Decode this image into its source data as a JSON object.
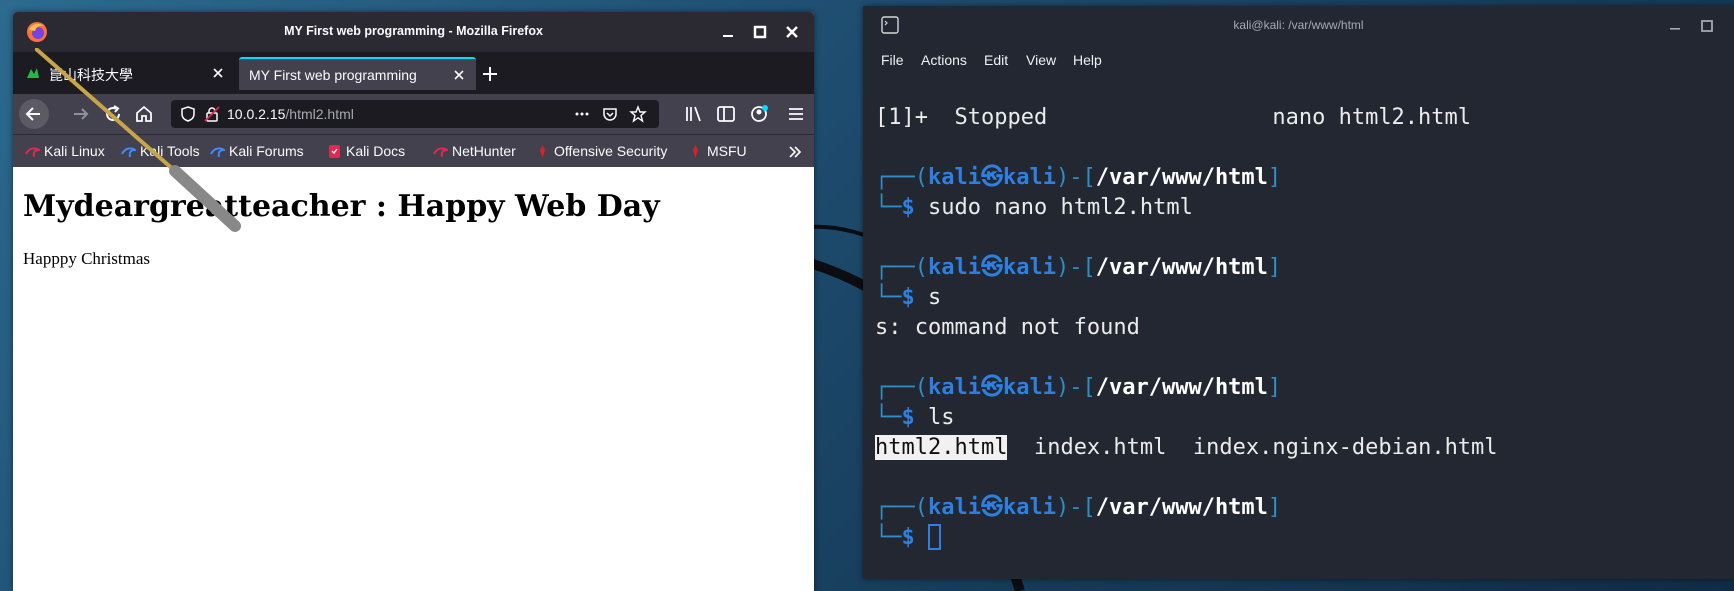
{
  "firefox": {
    "window_title": "MY First web programming - Mozilla Firefox",
    "tabs": [
      {
        "label": "崑山科技大學"
      },
      {
        "label": "MY First web programming"
      }
    ],
    "url": {
      "host": "10.0.2.15",
      "path": "/html2.html"
    },
    "bookmarks": [
      {
        "label": "Kali Linux"
      },
      {
        "label": "Kali Tools"
      },
      {
        "label": "Kali Forums"
      },
      {
        "label": "Kali Docs"
      },
      {
        "label": "NetHunter"
      },
      {
        "label": "Offensive Security"
      },
      {
        "label": "MSFU"
      }
    ],
    "page": {
      "heading": "Mydeargreatteacher : Happy Web Day",
      "paragraph": "Happpy Christmas"
    }
  },
  "terminal": {
    "window_title": "kali@kali: /var/www/html",
    "menu": [
      "File",
      "Actions",
      "Edit",
      "View",
      "Help"
    ],
    "prompt": {
      "open": "(",
      "user": "kali",
      "at": "㉿",
      "host": "kali",
      "mid": ")-[",
      "path": "/var/www/html",
      "close": "]",
      "dollar": "$"
    },
    "lines": {
      "stopped_job": "[1]+  Stopped                 nano html2.html",
      "cmd1": "sudo nano html2.html",
      "cmd2": "s",
      "out2": "s: command not found",
      "cmd3": "ls",
      "ls_files": [
        "html2.html",
        "index.html",
        "index.nginx-debian.html"
      ]
    }
  },
  "colors": {
    "firefox_titlebar": "#2b2a33",
    "firefox_toolbar": "#42414d",
    "firefox_accent": "#00ddff",
    "terminal_bg": "#222731",
    "prompt_blue": "#2f7fe0",
    "prompt_bracket": "#2e8ec7"
  }
}
